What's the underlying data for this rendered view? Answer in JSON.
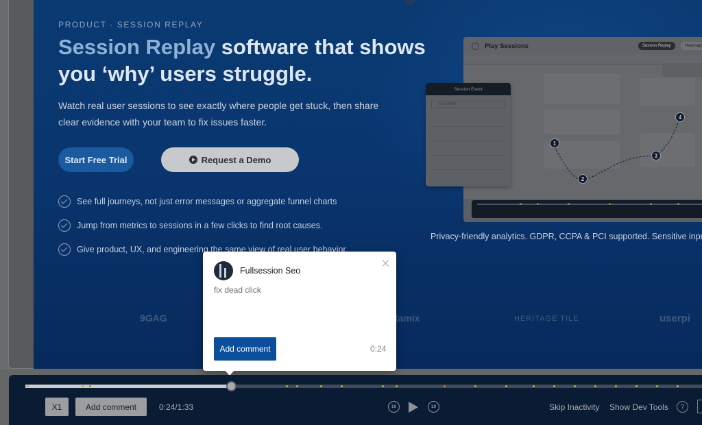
{
  "hero": {
    "eyebrow": "PRODUCT · SESSION REPLAY",
    "headline_accent": "Session Replay",
    "headline_rest": " software that shows you ‘why’ users struggle.",
    "subcopy": "Watch real user sessions to see exactly where people get stuck, then share clear evidence with your team to fix issues faster.",
    "cta_primary": "Start Free Trial",
    "cta_secondary": "Request a Demo",
    "features": [
      "See full journeys, not just error messages or aggregate funnel charts",
      "Jump from metrics to sessions in a few clicks to find root causes.",
      "Give product, UX, and engineering the same view of real user behavior."
    ],
    "privacy_note": "Privacy-friendly analytics. GDPR, CCPA & PCI supported. Sensitive input"
  },
  "mock": {
    "title": "Play Sessions",
    "tab_session_replay": "Session Replay",
    "tab_heatmaps": "Heatmaps",
    "panel_title": "Session Event",
    "panel_search": "Event Filter",
    "steps": [
      "1",
      "2",
      "3",
      "4"
    ]
  },
  "logos": [
    "9GAG",
    "tamix",
    "HERITAGE TILE",
    "userpi"
  ],
  "comment_popup": {
    "author": "Fullsession Seo",
    "text": "fix dead click",
    "button_label": "Add comment",
    "timestamp": "0:24"
  },
  "player": {
    "speed_label": "X1",
    "add_comment_label": "Add comment",
    "time_readout": "0:24/1:33",
    "progress": 0.305,
    "rewind_label": "10",
    "forward_label": "10",
    "skip_inactivity_label": "Skip Inactivity",
    "dev_tools_label": "Show Dev Tools",
    "help_label": "?"
  },
  "colors": {
    "player_bg": "#0a1c33",
    "accent_blue": "#0b4f9c",
    "marker_yellow": "#c8a93a",
    "marker_orange": "#d0742a"
  }
}
